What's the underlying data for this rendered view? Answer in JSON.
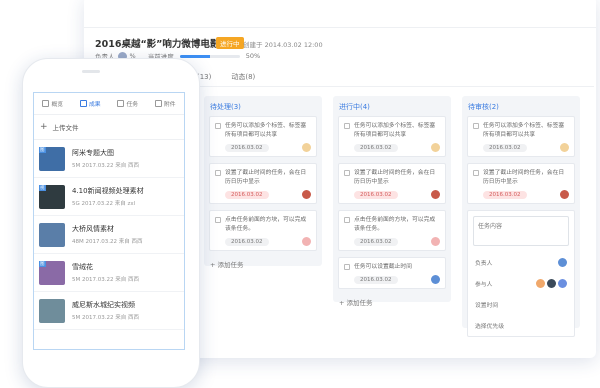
{
  "project": {
    "title": "2016桌越“影”响力微博电影之夜",
    "badge": "进行中",
    "created": "创建于 2014.03.02 12:00",
    "owner_label": "负责人",
    "owner_short": "%",
    "progress_label": "当前进度",
    "progress_value": 0.5,
    "progress_text": "50%"
  },
  "tabs": [
    "件(13)",
    "动态(8)"
  ],
  "columns": [
    {
      "header": "待处理(3)",
      "tasks": [
        {
          "text": "任务可以添加多个标签、标签塞所有项目都可以共享",
          "date": "2016.03.02",
          "red": false,
          "avatar_color": "#f2d29a"
        },
        {
          "text": "设置了截止时间的任务，会在日历日历中显示",
          "date": "2016.03.02",
          "red": true,
          "avatar_color": "#c85a4a"
        },
        {
          "text": "点击任务前面的方块，可以完成该条任务。",
          "date": "2016.03.02",
          "red": false,
          "avatar_color": "#f2b3b3"
        }
      ],
      "add": "+ 添加任务"
    },
    {
      "header": "进行中(4)",
      "tasks": [
        {
          "text": "任务可以添加多个标签、标签塞所有项目都可以共享",
          "date": "2016.03.02",
          "red": false,
          "avatar_color": "#f2d29a"
        },
        {
          "text": "设置了截止时间的任务，会在日历日历中显示",
          "date": "2016.03.02",
          "red": true,
          "avatar_color": "#c85a4a"
        },
        {
          "text": "点击任务前面的方块，可以完成该条任务。",
          "date": "2016.03.02",
          "red": false,
          "avatar_color": "#f2b3b3"
        },
        {
          "text": "任务可以设置截止时间",
          "date": "2016.03.02",
          "red": false,
          "avatar_color": "#5d8fd6"
        }
      ],
      "add": "+ 添加任务"
    },
    {
      "header": "待审核(2)",
      "tasks": [
        {
          "text": "任务可以添加多个标签、标签塞所有项目都可以共享",
          "date": "2016.03.02",
          "red": false,
          "avatar_color": "#f2d29a"
        },
        {
          "text": "设置了截止时间的任务，会在日历日历中显示",
          "date": "2016.03.02",
          "red": true,
          "avatar_color": "#c85a4a"
        }
      ],
      "form": {
        "placeholder": "任务内容",
        "owner": "负责人",
        "participants": "参与人",
        "set_time": "设置时间",
        "priority": "选择优先级"
      }
    }
  ],
  "mobile": {
    "tabs": [
      {
        "label": "概览",
        "active": false
      },
      {
        "label": "成果",
        "active": true
      },
      {
        "label": "任务",
        "active": false
      },
      {
        "label": "附件",
        "active": false
      }
    ],
    "upload": "上传文件",
    "files": [
      {
        "name": "阿米专题大图",
        "meta": "5M   2017.03.22   来自 西西",
        "thumb": "#3f6ea6",
        "tag": "图"
      },
      {
        "name": "4.10新闻视频处理素材",
        "meta": "5G   2017.03.22   来自 zxl",
        "thumb": "#2f3b40",
        "tag": "视"
      },
      {
        "name": "大桥风情素材",
        "meta": "48M   2017.03.22   来自 西西",
        "thumb": "#5a7ea8",
        "tag": ""
      },
      {
        "name": "雪绒花",
        "meta": "5M   2017.03.22   来自 西西",
        "thumb": "#8a6aa6",
        "tag": "图"
      },
      {
        "name": "威尼斯水城纪实视频",
        "meta": "5M   2017.03.22   来自 西西",
        "thumb": "#6f8d9b",
        "tag": ""
      }
    ]
  }
}
